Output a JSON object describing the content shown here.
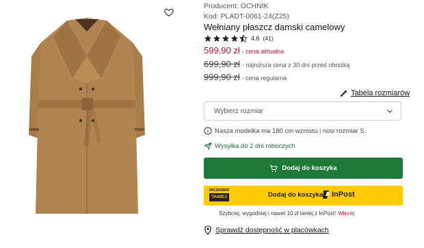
{
  "product": {
    "producer": "Producent: OCHNIK",
    "code": "Kod: PLADT-0061-24(Z25)",
    "title": "Wełniany płaszcz damski camelowy",
    "rating_value": "4.6",
    "rating_count": "(41)",
    "rating_stars": 4.6
  },
  "prices": {
    "current": "599,90 zł",
    "current_label": "- cena aktualna",
    "lowest": "699,90 zł",
    "lowest_label": "- najniższa cena z 30 dni przed obniżką",
    "regular": "999,90 zł",
    "regular_label": "- cena regularna"
  },
  "size": {
    "table_link": "Tabela rozmiarów",
    "select_placeholder": "Wybierz rozmiar"
  },
  "notes": {
    "model": "Nasza modelka ma 180 cm wzrostu i nosi rozmiar S.",
    "shipping": "Wysyłka do 2 dni roboczych"
  },
  "buttons": {
    "add_to_cart": "Dodaj do koszyka",
    "inpost_badge_top": "PACZKOMAT",
    "inpost_badge_bottom": "TANIEJ",
    "inpost_label": "Dodaj do koszyka",
    "inpost_brand": "InPost"
  },
  "promo": {
    "text": "Szybciej, wygodniej i nawet 10 zł taniej z InPost!",
    "more": "Więcej"
  },
  "stores": {
    "link": "Sprawdź dostępność w placówkach"
  },
  "colors": {
    "accent_green": "#1f7a39",
    "price_red": "#c8102e",
    "inpost_yellow": "#ffcb05",
    "coat_camel": "#b08551"
  },
  "icons": [
    "heart-icon",
    "star-icon",
    "star-half-icon",
    "hanger-icon",
    "chevron-down-icon",
    "info-icon",
    "send-icon",
    "cart-icon",
    "inpost-logo-icon",
    "location-pin-icon"
  ]
}
